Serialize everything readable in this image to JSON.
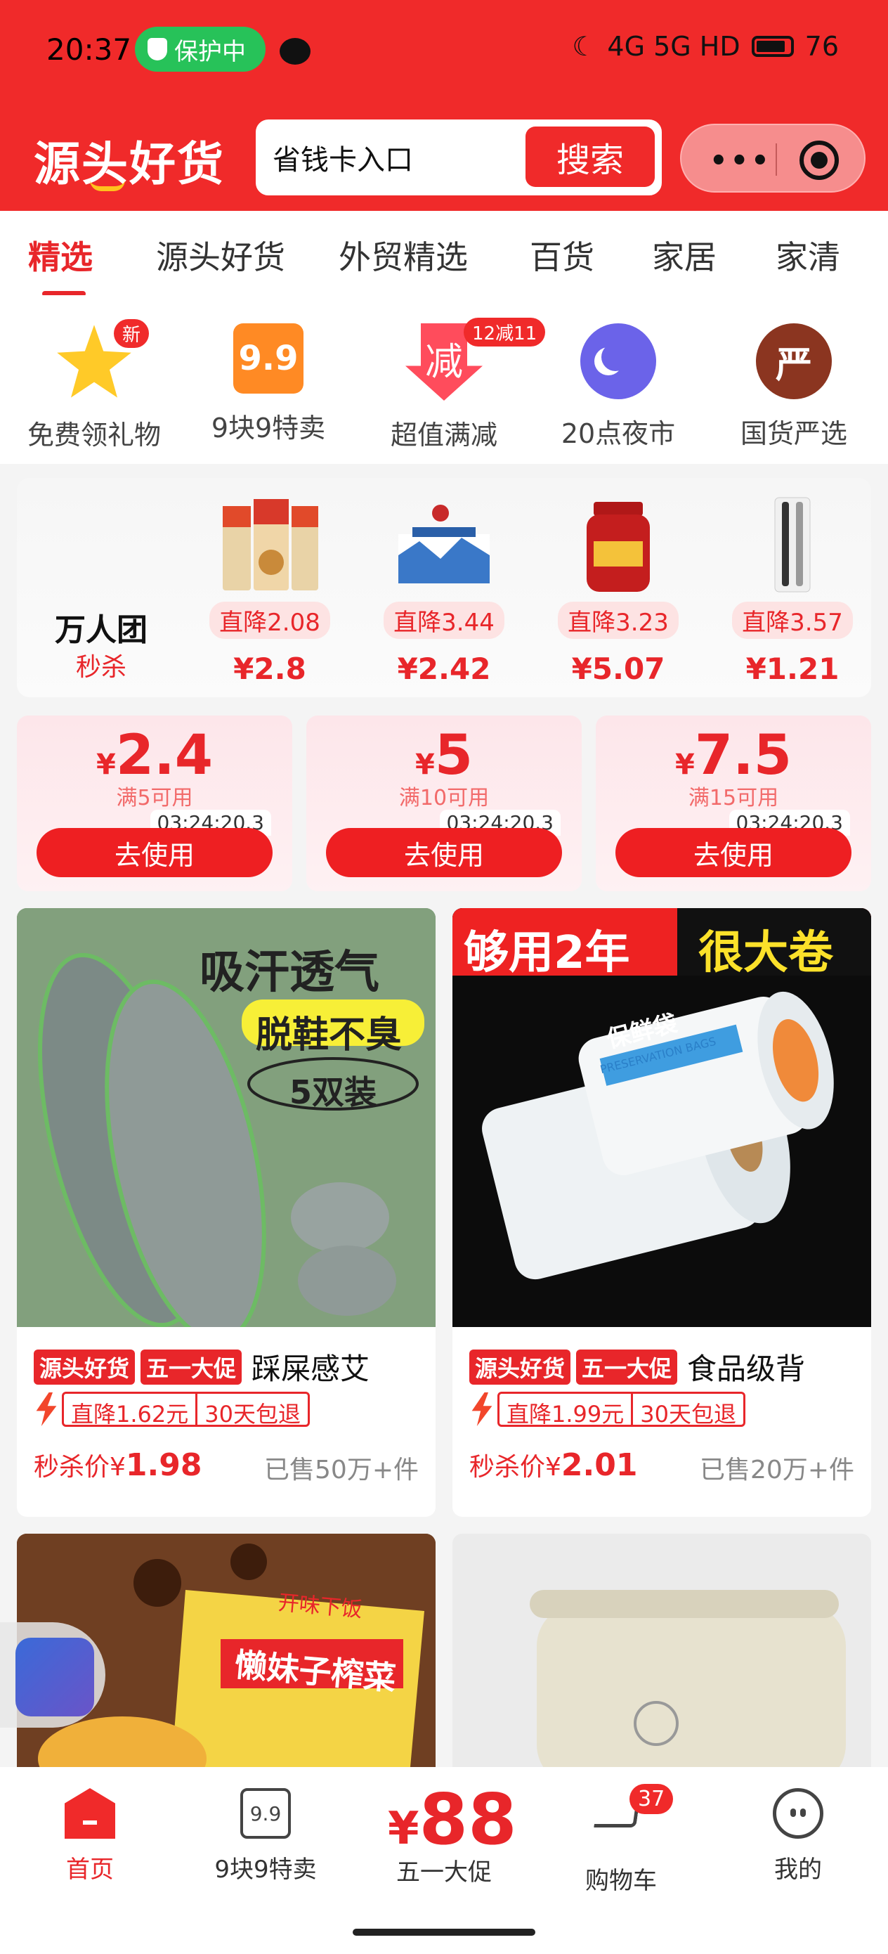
{
  "status_bar": {
    "time": "20:37",
    "protect_label": "保护中",
    "network": "4G 5G HD",
    "battery": "76"
  },
  "header": {
    "logo": "源头好货",
    "search_placeholder": "省钱卡入口",
    "search_button": "搜索",
    "more_label": "•••"
  },
  "tabs": [
    "精选",
    "源头好货",
    "外贸精选",
    "百货",
    "家居",
    "家清"
  ],
  "quick_icons": [
    {
      "label": "免费领礼物",
      "badge": "新",
      "icon": "star-icon"
    },
    {
      "label": "9块9特卖",
      "glyph": "9.9",
      "icon": "nine-nine-icon"
    },
    {
      "label": "超值满减",
      "badge": "12减11",
      "glyph": "减",
      "icon": "discount-arrow-icon"
    },
    {
      "label": "20点夜市",
      "icon": "moon-icon"
    },
    {
      "label": "国货严选",
      "glyph": "严",
      "icon": "yan-icon"
    }
  ],
  "flash_sale": {
    "title": "万人团",
    "subtitle": "秒杀",
    "items": [
      {
        "drop": "直降2.08",
        "price": "¥2.8"
      },
      {
        "drop": "直降3.44",
        "price": "¥2.42"
      },
      {
        "drop": "直降3.23",
        "price": "¥5.07"
      },
      {
        "drop": "直降3.57",
        "price": "¥1.21"
      }
    ]
  },
  "coupons": [
    {
      "symbol": "¥",
      "value": "2.4",
      "condition": "满5可用",
      "timer": "03:24:20.3",
      "button": "去使用"
    },
    {
      "symbol": "¥",
      "value": "5",
      "condition": "满10可用",
      "timer": "03:24:20.3",
      "button": "去使用"
    },
    {
      "symbol": "¥",
      "value": "7.5",
      "condition": "满15可用",
      "timer": "03:24:20.3",
      "button": "去使用"
    }
  ],
  "products": [
    {
      "image_text": [
        "吸汗透气",
        "脱鞋不臭",
        "5双装"
      ],
      "tag1": "源头好货",
      "tag2": "五一大促",
      "title": "踩屎感艾",
      "drop": "直降1.62元",
      "return": "30天包退",
      "price_label": "秒杀价¥",
      "price": "1.98",
      "sold": "已售50万+件"
    },
    {
      "image_text": [
        "够用2年",
        "很大卷",
        "保鲜袋",
        "PRESERVATION BAGS"
      ],
      "tag1": "源头好货",
      "tag2": "五一大促",
      "title": "食品级背",
      "drop": "直降1.99元",
      "return": "30天包退",
      "price_label": "秒杀价¥",
      "price": "2.01",
      "sold": "已售20万+件"
    },
    {
      "image_text": [
        "开味下饭",
        "懒妹子榨菜"
      ]
    },
    {
      "image_text": []
    }
  ],
  "bottom_nav": [
    {
      "label": "首页",
      "active": true
    },
    {
      "label": "9块9特卖",
      "glyph": "9.9"
    },
    {
      "label": "五一大促",
      "big_symbol": "¥",
      "big_value": "88"
    },
    {
      "label": "购物车",
      "badge": "37"
    },
    {
      "label": "我的"
    }
  ],
  "colors": {
    "brand_red": "#f02a2a",
    "accent_red": "#e8262a",
    "protect_green": "#27c259"
  }
}
